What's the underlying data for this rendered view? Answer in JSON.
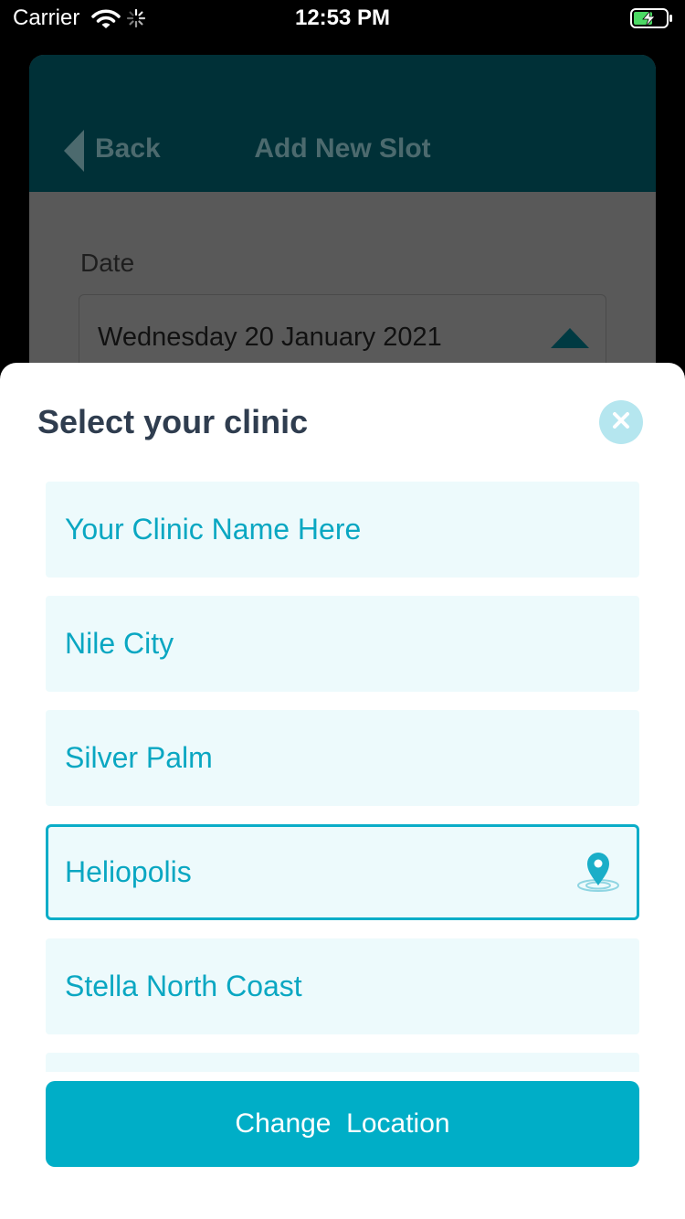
{
  "status_bar": {
    "carrier": "Carrier",
    "time": "12:53 PM"
  },
  "background": {
    "header": {
      "back_label": "Back",
      "title": "Add New Slot"
    },
    "date_label": "Date",
    "date_value": "Wednesday 20 January 2021"
  },
  "sheet": {
    "title": "Select your clinic",
    "clinics": [
      {
        "label": "Your Clinic Name Here",
        "selected": false
      },
      {
        "label": "Nile City",
        "selected": false
      },
      {
        "label": "Silver Palm",
        "selected": false
      },
      {
        "label": "Heliopolis",
        "selected": true
      },
      {
        "label": "Stella North Coast",
        "selected": false
      },
      {
        "label": "",
        "selected": false
      }
    ],
    "change_location_label": "Change  Location"
  },
  "colors": {
    "accent": "#00aec7",
    "item_background": "#edfafc",
    "item_text": "#0aa7c2",
    "title_text": "#2f3d4f",
    "close_button": "#b5e6ef",
    "header_dark": "#003037"
  },
  "icons": {
    "close": "close-icon",
    "location": "location-pin-icon",
    "back": "back-arrow-icon"
  }
}
